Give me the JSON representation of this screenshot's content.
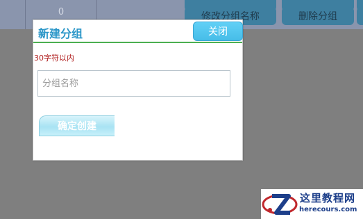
{
  "background": {
    "cell_value": "0",
    "buttons": [
      "修改分组名称",
      "删除分组"
    ]
  },
  "dialog": {
    "title": "新建分组",
    "close_label": "关闭",
    "hint": "30字符以内",
    "input_placeholder": "分组名称",
    "input_value": "",
    "confirm_label": "确定创建"
  },
  "watermark": {
    "line1": "这里教程网",
    "line2": "herecours.com"
  }
}
